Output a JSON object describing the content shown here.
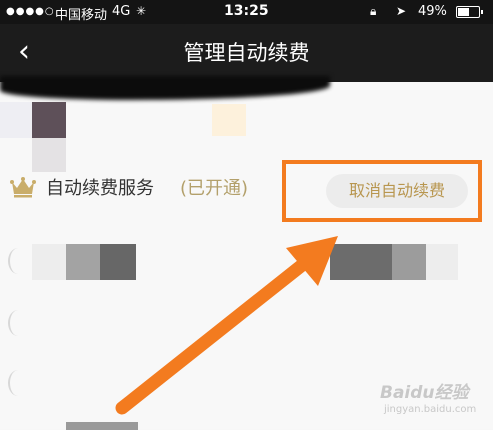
{
  "status_bar": {
    "signal": "●●●●○",
    "carrier": "中国移动",
    "network": "4G",
    "loading_glyph": "✳",
    "time": "13:25",
    "battery_percent": "49%"
  },
  "nav": {
    "back_glyph": "‹",
    "title": "管理自动续费"
  },
  "service": {
    "label": "自动续费服务",
    "status": "(已开通)",
    "cancel_button": "取消自动续费"
  },
  "watermark": {
    "brand": "Baidu经验",
    "site": "jingyan.baidu.com"
  },
  "colors": {
    "highlight": "#f37b1f",
    "gold": "#b8964f",
    "nav_bg": "#1c1c1c"
  }
}
